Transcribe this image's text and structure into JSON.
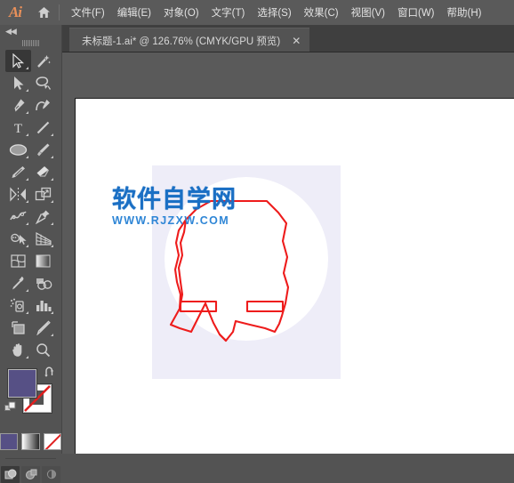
{
  "app": {
    "logo_text": "Ai",
    "home_icon": "home-icon"
  },
  "menubar": {
    "items": [
      {
        "label": "文件(F)",
        "name": "menu-file"
      },
      {
        "label": "编辑(E)",
        "name": "menu-edit"
      },
      {
        "label": "对象(O)",
        "name": "menu-object"
      },
      {
        "label": "文字(T)",
        "name": "menu-type"
      },
      {
        "label": "选择(S)",
        "name": "menu-select"
      },
      {
        "label": "效果(C)",
        "name": "menu-effect"
      },
      {
        "label": "视图(V)",
        "name": "menu-view"
      },
      {
        "label": "窗口(W)",
        "name": "menu-window"
      },
      {
        "label": "帮助(H)",
        "name": "menu-help"
      }
    ]
  },
  "tabs": {
    "active": {
      "label": "未标题-1.ai* @ 126.76% (CMYK/GPU 预览)",
      "close_glyph": "✕"
    }
  },
  "toolpanel": {
    "collapse_glyph": "◀◀",
    "tools": [
      {
        "label": "选择工具",
        "name": "selection-tool",
        "icon": "selection-arrow-icon",
        "active": true,
        "corner": true
      },
      {
        "label": "魔棒工具",
        "name": "magic-wand-tool",
        "icon": "magic-wand-icon",
        "active": false,
        "corner": false
      },
      {
        "label": "直接选择工具",
        "name": "direct-selection-tool",
        "icon": "direct-selection-icon",
        "active": false,
        "corner": true
      },
      {
        "label": "套索工具",
        "name": "lasso-tool",
        "icon": "lasso-icon",
        "active": false,
        "corner": false
      },
      {
        "label": "钢笔工具",
        "name": "pen-tool",
        "icon": "pen-icon",
        "active": false,
        "corner": true
      },
      {
        "label": "曲率工具",
        "name": "curvature-tool",
        "icon": "curvature-icon",
        "active": false,
        "corner": false
      },
      {
        "label": "文字工具",
        "name": "type-tool",
        "icon": "type-t-icon",
        "active": false,
        "corner": true
      },
      {
        "label": "直线段工具",
        "name": "line-segment-tool",
        "icon": "line-segment-icon",
        "active": false,
        "corner": true
      },
      {
        "label": "椭圆工具",
        "name": "ellipse-tool",
        "icon": "ellipse-icon",
        "active": false,
        "corner": true
      },
      {
        "label": "画笔工具",
        "name": "paintbrush-tool",
        "icon": "paintbrush-icon",
        "active": false,
        "corner": true
      },
      {
        "label": "铅笔工具",
        "name": "pencil-tool",
        "icon": "pencil-shaper-icon",
        "active": false,
        "corner": true
      },
      {
        "label": "橡皮擦工具",
        "name": "eraser-tool",
        "icon": "eraser-icon",
        "active": false,
        "corner": true
      },
      {
        "label": "旋转工具",
        "name": "rotate-tool",
        "icon": "reflect-icon",
        "active": false,
        "corner": true
      },
      {
        "label": "比例缩放工具",
        "name": "scale-tool",
        "icon": "scale-icon",
        "active": false,
        "corner": true
      },
      {
        "label": "宽度工具",
        "name": "width-tool",
        "icon": "warp-icon",
        "active": false,
        "corner": true
      },
      {
        "label": "自由变换工具",
        "name": "free-transform-tool",
        "icon": "pin-icon",
        "active": false,
        "corner": true
      },
      {
        "label": "形状生成器",
        "name": "shape-builder-tool",
        "icon": "shape-builder-icon",
        "active": false,
        "corner": true
      },
      {
        "label": "透视网格工具",
        "name": "perspective-grid-tool",
        "icon": "perspective-grid-icon",
        "active": false,
        "corner": true
      },
      {
        "label": "网格工具",
        "name": "mesh-tool",
        "icon": "mesh-icon",
        "active": false,
        "corner": false
      },
      {
        "label": "渐变工具",
        "name": "gradient-tool",
        "icon": "gradient-icon",
        "active": false,
        "corner": false
      },
      {
        "label": "吸管工具",
        "name": "eyedropper-tool",
        "icon": "eyedropper-icon",
        "active": false,
        "corner": true
      },
      {
        "label": "混合工具",
        "name": "blend-tool",
        "icon": "blend-icon",
        "active": false,
        "corner": false
      },
      {
        "label": "符号喷枪工具",
        "name": "symbol-sprayer-tool",
        "icon": "symbol-sprayer-icon",
        "active": false,
        "corner": true
      },
      {
        "label": "柱形图工具",
        "name": "column-graph-tool",
        "icon": "column-graph-icon",
        "active": false,
        "corner": true
      },
      {
        "label": "画板工具",
        "name": "artboard-tool",
        "icon": "artboard-icon",
        "active": false,
        "corner": false
      },
      {
        "label": "切片工具",
        "name": "slice-tool",
        "icon": "slice-knife-icon",
        "active": false,
        "corner": true
      },
      {
        "label": "抓手工具",
        "name": "hand-tool",
        "icon": "hand-icon",
        "active": false,
        "corner": true
      },
      {
        "label": "缩放工具",
        "name": "zoom-tool",
        "icon": "magnifier-icon",
        "active": false,
        "corner": false
      }
    ],
    "colors": {
      "fill": "#565085",
      "stroke": "#ffffff",
      "none_slash": "#e02020"
    },
    "fill_stroke": {
      "fill_name": "fill-swatch",
      "stroke_name": "stroke-swatch",
      "swap_name": "swap-fill-stroke-icon",
      "default_name": "default-fill-stroke-icon"
    },
    "paint_modes": [
      {
        "label": "颜色",
        "name": "paint-mode-color",
        "type": "solid"
      },
      {
        "label": "渐变",
        "name": "paint-mode-gradient",
        "type": "gradient"
      },
      {
        "label": "无",
        "name": "paint-mode-none",
        "type": "none"
      }
    ],
    "screen_modes": [
      {
        "label": "正常屏幕模式",
        "name": "screen-mode-normal",
        "active": true
      },
      {
        "label": "带菜单栏全屏模式",
        "name": "screen-mode-fullmenu",
        "active": false
      },
      {
        "label": "全屏模式",
        "name": "screen-mode-full",
        "active": false
      }
    ]
  },
  "canvas": {
    "artwork_name": "vest-outline-artwork",
    "background_rect_color": "#eeedf8",
    "circle_color": "#ffffff",
    "stroke_color": "#ee1c1c",
    "zoom_level": "126.76%"
  },
  "watermark": {
    "main": "软件自学网",
    "sub": "WWW.RJZXW.COM",
    "color": "#1a6fc4"
  }
}
